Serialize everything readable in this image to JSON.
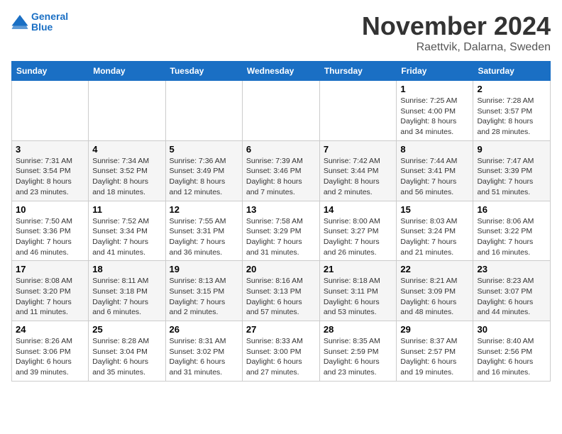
{
  "logo": {
    "line1": "General",
    "line2": "Blue"
  },
  "title": "November 2024",
  "location": "Raettvik, Dalarna, Sweden",
  "headers": [
    "Sunday",
    "Monday",
    "Tuesday",
    "Wednesday",
    "Thursday",
    "Friday",
    "Saturday"
  ],
  "weeks": [
    [
      {
        "day": "",
        "info": ""
      },
      {
        "day": "",
        "info": ""
      },
      {
        "day": "",
        "info": ""
      },
      {
        "day": "",
        "info": ""
      },
      {
        "day": "",
        "info": ""
      },
      {
        "day": "1",
        "info": "Sunrise: 7:25 AM\nSunset: 4:00 PM\nDaylight: 8 hours\nand 34 minutes."
      },
      {
        "day": "2",
        "info": "Sunrise: 7:28 AM\nSunset: 3:57 PM\nDaylight: 8 hours\nand 28 minutes."
      }
    ],
    [
      {
        "day": "3",
        "info": "Sunrise: 7:31 AM\nSunset: 3:54 PM\nDaylight: 8 hours\nand 23 minutes."
      },
      {
        "day": "4",
        "info": "Sunrise: 7:34 AM\nSunset: 3:52 PM\nDaylight: 8 hours\nand 18 minutes."
      },
      {
        "day": "5",
        "info": "Sunrise: 7:36 AM\nSunset: 3:49 PM\nDaylight: 8 hours\nand 12 minutes."
      },
      {
        "day": "6",
        "info": "Sunrise: 7:39 AM\nSunset: 3:46 PM\nDaylight: 8 hours\nand 7 minutes."
      },
      {
        "day": "7",
        "info": "Sunrise: 7:42 AM\nSunset: 3:44 PM\nDaylight: 8 hours\nand 2 minutes."
      },
      {
        "day": "8",
        "info": "Sunrise: 7:44 AM\nSunset: 3:41 PM\nDaylight: 7 hours\nand 56 minutes."
      },
      {
        "day": "9",
        "info": "Sunrise: 7:47 AM\nSunset: 3:39 PM\nDaylight: 7 hours\nand 51 minutes."
      }
    ],
    [
      {
        "day": "10",
        "info": "Sunrise: 7:50 AM\nSunset: 3:36 PM\nDaylight: 7 hours\nand 46 minutes."
      },
      {
        "day": "11",
        "info": "Sunrise: 7:52 AM\nSunset: 3:34 PM\nDaylight: 7 hours\nand 41 minutes."
      },
      {
        "day": "12",
        "info": "Sunrise: 7:55 AM\nSunset: 3:31 PM\nDaylight: 7 hours\nand 36 minutes."
      },
      {
        "day": "13",
        "info": "Sunrise: 7:58 AM\nSunset: 3:29 PM\nDaylight: 7 hours\nand 31 minutes."
      },
      {
        "day": "14",
        "info": "Sunrise: 8:00 AM\nSunset: 3:27 PM\nDaylight: 7 hours\nand 26 minutes."
      },
      {
        "day": "15",
        "info": "Sunrise: 8:03 AM\nSunset: 3:24 PM\nDaylight: 7 hours\nand 21 minutes."
      },
      {
        "day": "16",
        "info": "Sunrise: 8:06 AM\nSunset: 3:22 PM\nDaylight: 7 hours\nand 16 minutes."
      }
    ],
    [
      {
        "day": "17",
        "info": "Sunrise: 8:08 AM\nSunset: 3:20 PM\nDaylight: 7 hours\nand 11 minutes."
      },
      {
        "day": "18",
        "info": "Sunrise: 8:11 AM\nSunset: 3:18 PM\nDaylight: 7 hours\nand 6 minutes."
      },
      {
        "day": "19",
        "info": "Sunrise: 8:13 AM\nSunset: 3:15 PM\nDaylight: 7 hours\nand 2 minutes."
      },
      {
        "day": "20",
        "info": "Sunrise: 8:16 AM\nSunset: 3:13 PM\nDaylight: 6 hours\nand 57 minutes."
      },
      {
        "day": "21",
        "info": "Sunrise: 8:18 AM\nSunset: 3:11 PM\nDaylight: 6 hours\nand 53 minutes."
      },
      {
        "day": "22",
        "info": "Sunrise: 8:21 AM\nSunset: 3:09 PM\nDaylight: 6 hours\nand 48 minutes."
      },
      {
        "day": "23",
        "info": "Sunrise: 8:23 AM\nSunset: 3:07 PM\nDaylight: 6 hours\nand 44 minutes."
      }
    ],
    [
      {
        "day": "24",
        "info": "Sunrise: 8:26 AM\nSunset: 3:06 PM\nDaylight: 6 hours\nand 39 minutes."
      },
      {
        "day": "25",
        "info": "Sunrise: 8:28 AM\nSunset: 3:04 PM\nDaylight: 6 hours\nand 35 minutes."
      },
      {
        "day": "26",
        "info": "Sunrise: 8:31 AM\nSunset: 3:02 PM\nDaylight: 6 hours\nand 31 minutes."
      },
      {
        "day": "27",
        "info": "Sunrise: 8:33 AM\nSunset: 3:00 PM\nDaylight: 6 hours\nand 27 minutes."
      },
      {
        "day": "28",
        "info": "Sunrise: 8:35 AM\nSunset: 2:59 PM\nDaylight: 6 hours\nand 23 minutes."
      },
      {
        "day": "29",
        "info": "Sunrise: 8:37 AM\nSunset: 2:57 PM\nDaylight: 6 hours\nand 19 minutes."
      },
      {
        "day": "30",
        "info": "Sunrise: 8:40 AM\nSunset: 2:56 PM\nDaylight: 6 hours\nand 16 minutes."
      }
    ]
  ]
}
